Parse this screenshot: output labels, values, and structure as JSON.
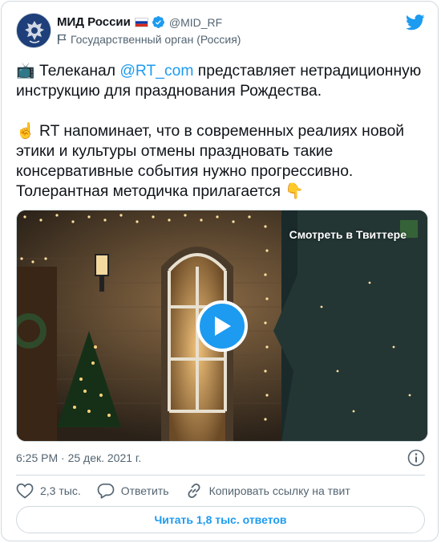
{
  "author": {
    "display_name": "МИД России",
    "handle": "@MID_RF",
    "label": "Государственный орган (Россия)"
  },
  "tweet": {
    "para1_pre": " Телеканал ",
    "para1_mention": "@RT_com",
    "para1_post": " представляет нетрадиционную инструкцию для празднования Рождества.",
    "para2": " RT напоминает, что в современных реалиях новой этики и культуры отмены праздновать такие консервативные события нужно прогрессивно. Толерантная методичка прилагается ",
    "emoji_tv": "📺",
    "emoji_point_up": "☝️",
    "emoji_point_down": "👇"
  },
  "media": {
    "watch_label": "Смотреть в Твиттере"
  },
  "meta": {
    "timestamp": "6:25 PM · 25 дек. 2021 г."
  },
  "actions": {
    "likes": "2,3 тыс.",
    "reply": "Ответить",
    "copy_link": "Копировать ссылку на твит",
    "read_replies": "Читать 1,8 тыс. ответов"
  },
  "colors": {
    "accent": "#1d9bf0",
    "text": "#0f1419",
    "secondary": "#536471",
    "border": "#cfd9de"
  }
}
